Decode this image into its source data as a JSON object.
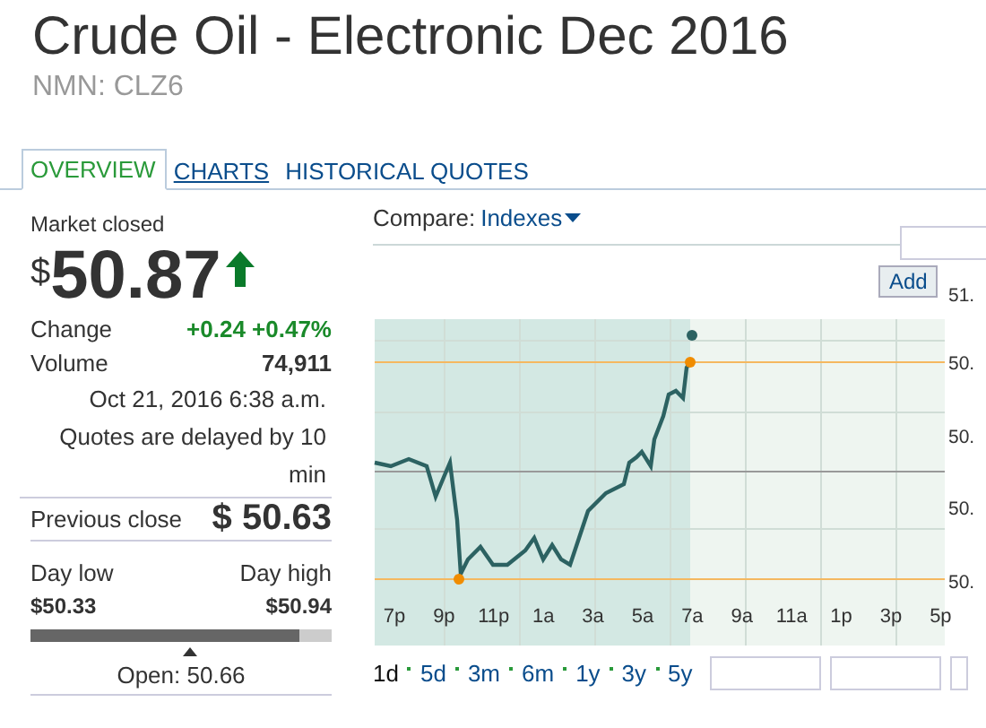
{
  "header": {
    "title": "Crude Oil - Electronic Dec 2016",
    "symbol": "NMN: CLZ6"
  },
  "tabs": [
    {
      "label": "OVERVIEW",
      "selected": true
    },
    {
      "label": "CHARTS",
      "selected": false
    },
    {
      "label": "HISTORICAL QUOTES",
      "selected": false
    }
  ],
  "quote": {
    "status": "Market closed",
    "currency": "$",
    "price": "50.87",
    "rising": true,
    "stats": [
      {
        "label": "Change",
        "value": "+0.24 +0.47%",
        "kind": "change"
      },
      {
        "label": "Volume",
        "value": "74,911",
        "kind": "plain"
      }
    ],
    "timestamp": "Oct 21, 2016 6:38 a.m.",
    "delay_note": "Quotes are delayed by 10 min",
    "previous_close": {
      "label": "Previous close",
      "value": "$ 50.63"
    },
    "day_range": {
      "low_label": "Day low",
      "high_label": "Day high",
      "low": "$50.33",
      "high": "$50.94",
      "level": 0.89
    },
    "open_marker": {
      "level": 0.53
    },
    "open": "Open: 50.66"
  },
  "chart": {
    "compare_label": "Compare:",
    "compare_menu": "Indexes",
    "add_button": "Add",
    "y_axis_labels": [
      "51.",
      "50.",
      "50.",
      "50.",
      "50."
    ],
    "x_axis_labels": [
      "7p",
      "9p",
      "11p",
      "1a",
      "3a",
      "5a",
      "7a",
      "9a",
      "11a",
      "1p",
      "3p",
      "5p"
    ],
    "periods": [
      {
        "label": "1d",
        "selected": true
      },
      {
        "label": "5d",
        "selected": false
      },
      {
        "label": "3m",
        "selected": false
      },
      {
        "label": "6m",
        "selected": false
      },
      {
        "label": "1y",
        "selected": false
      },
      {
        "label": "3y",
        "selected": false
      },
      {
        "label": "5y",
        "selected": false
      }
    ]
  }
}
